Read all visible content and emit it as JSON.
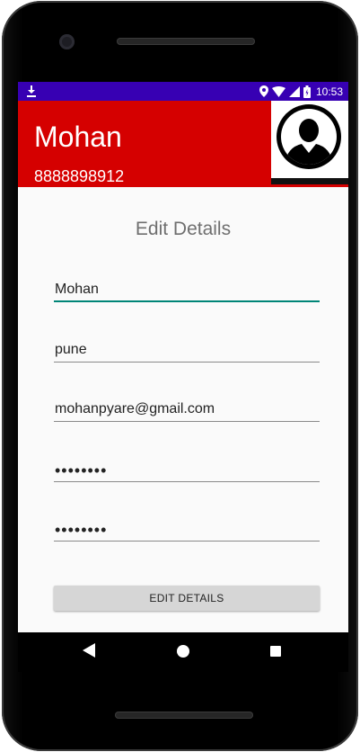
{
  "status_bar": {
    "time": "10:53",
    "icons": [
      "download-icon",
      "location-icon",
      "wifi-icon",
      "signal-icon",
      "battery-icon"
    ]
  },
  "header": {
    "name": "Mohan",
    "phone": "8888898912",
    "avatar_icon": "person-silhouette-icon"
  },
  "form": {
    "title": "Edit Details",
    "fields": [
      {
        "id": "name",
        "value": "Mohan"
      },
      {
        "id": "city",
        "value": "pune"
      },
      {
        "id": "email",
        "value": "mohanpyare@gmail.com"
      },
      {
        "id": "password",
        "value": "••••••••"
      },
      {
        "id": "confirm_password",
        "value": "••••••••"
      }
    ],
    "submit_label": "EDIT DETAILS"
  },
  "colors": {
    "status_bar": "#3700b3",
    "header": "#d50000",
    "focused_underline": "#008577"
  },
  "nav": {
    "icons": [
      "back-icon",
      "home-icon",
      "recent-apps-icon"
    ]
  }
}
